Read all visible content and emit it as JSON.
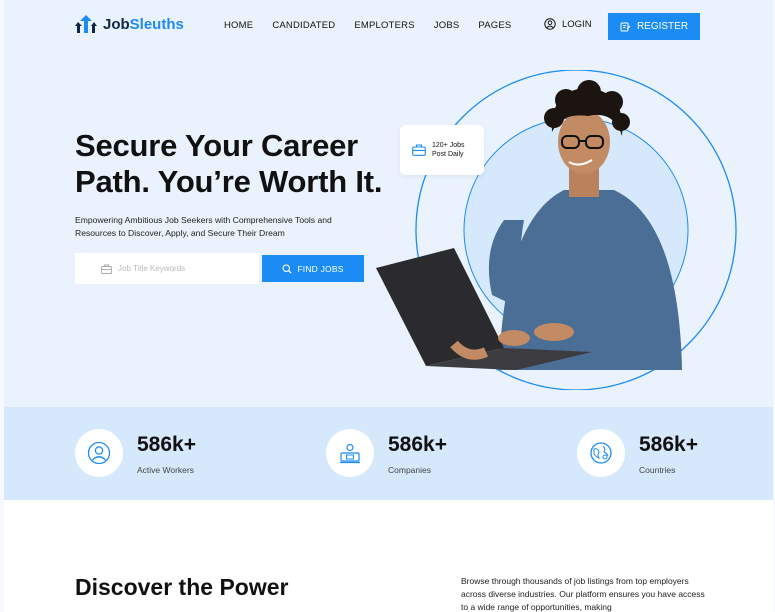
{
  "brand": {
    "name_prefix": "Job",
    "name_suffix": "Sleuths"
  },
  "nav": {
    "items": [
      {
        "label": "HOME"
      },
      {
        "label": "CANDIDATED"
      },
      {
        "label": "EMPLOTERS"
      },
      {
        "label": "JOBS"
      },
      {
        "label": "PAGES"
      }
    ],
    "login_label": "LOGIN",
    "register_label": "REGISTER"
  },
  "hero": {
    "title_line1": "Secure Your Career",
    "title_line2": "Path. You’re Worth It.",
    "subtitle": "Empowering Ambitious Job Seekers with Comprehensive Tools and Resources to Discover, Apply, and Secure Their Dream",
    "search_placeholder": "Job Title Keywords",
    "find_button": "FIND JOBS",
    "badge_line1": "120+ Jobs",
    "badge_line2": "Post Daily"
  },
  "stats": [
    {
      "value": "586k+",
      "label": "Active Workers",
      "icon": "user-icon"
    },
    {
      "value": "586k+",
      "label": "Companies",
      "icon": "company-icon"
    },
    {
      "value": "586k+",
      "label": "Countries",
      "icon": "globe-icon"
    }
  ],
  "section": {
    "heading": "Discover the Power",
    "text": "Browse through thousands of job listings from top employers across diverse industries. Our platform ensures you have access to a wide range of opportunities, making"
  },
  "colors": {
    "accent": "#1b8cf4",
    "hero_bg": "#eaf3fd",
    "stats_bg": "#d6e8fb"
  }
}
